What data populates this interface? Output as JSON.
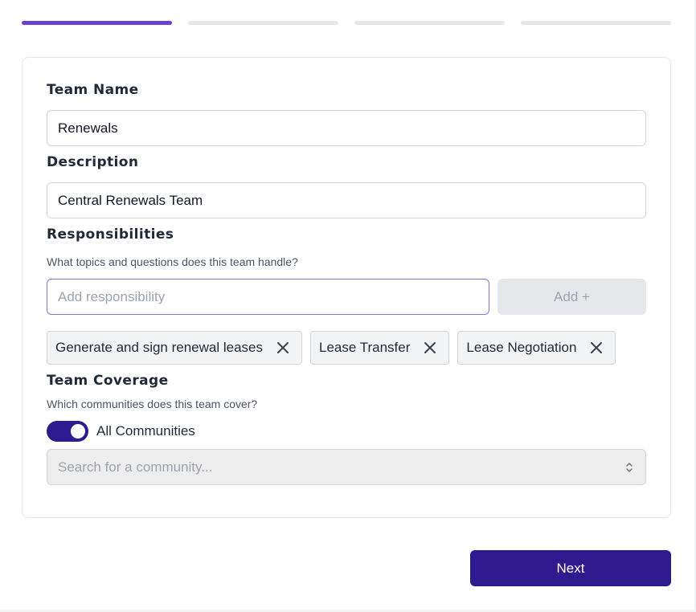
{
  "stepper": {
    "total_steps": 4,
    "current_step": 1
  },
  "form": {
    "team_name": {
      "label": "Team Name",
      "value": "Renewals"
    },
    "description": {
      "label": "Description",
      "value": "Central Renewals Team"
    },
    "responsibilities": {
      "label": "Responsibilities",
      "helper": "What topics and questions does this team handle?",
      "input_placeholder": "Add responsibility",
      "add_button_label": "Add +",
      "chips": [
        {
          "label": "Generate and sign renewal leases",
          "icon": "close-icon"
        },
        {
          "label": "Lease Transfer",
          "icon": "close-icon"
        },
        {
          "label": "Lease Negotiation",
          "icon": "close-icon"
        }
      ]
    },
    "team_coverage": {
      "label": "Team Coverage",
      "helper": "Which communities does this team cover?",
      "toggle_label": "All Communities",
      "toggle_on": true,
      "search_placeholder": "Search for a community...",
      "search_icon": "chevron-up-down-icon"
    }
  },
  "footer": {
    "next_label": "Next"
  },
  "colors": {
    "accent": "#6d3fd2",
    "primary": "#2e1a8e",
    "inactive_step": "#e5e7eb"
  }
}
